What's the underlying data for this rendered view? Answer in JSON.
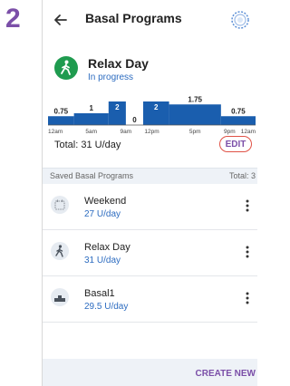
{
  "step_number": "2",
  "header": {
    "title": "Basal Programs",
    "back_icon": "back-arrow-icon",
    "status_icon": "pod-status-icon"
  },
  "active_program": {
    "name": "Relax Day",
    "status": "In progress",
    "icon": "walking-person-icon",
    "total_label": "Total: 31 U/day",
    "edit_label": "EDIT"
  },
  "chart_data": {
    "type": "bar",
    "segments": [
      {
        "start_hour": 0,
        "end_hour": 3,
        "rate": 0.75,
        "label": "0.75"
      },
      {
        "start_hour": 3,
        "end_hour": 7,
        "rate": 1,
        "label": "1"
      },
      {
        "start_hour": 7,
        "end_hour": 9,
        "rate": 2,
        "label": "2"
      },
      {
        "start_hour": 9,
        "end_hour": 11,
        "rate": 0,
        "label": "0"
      },
      {
        "start_hour": 11,
        "end_hour": 14,
        "rate": 2,
        "label": "2"
      },
      {
        "start_hour": 14,
        "end_hour": 20,
        "rate": 1.75,
        "label": "1.75"
      },
      {
        "start_hour": 20,
        "end_hour": 24,
        "rate": 0.75,
        "label": "0.75"
      }
    ],
    "xticks": [
      "12am",
      "5am",
      "9am",
      "12pm",
      "5pm",
      "9pm",
      "12am"
    ],
    "xtick_hours": [
      0,
      5,
      9,
      12,
      17,
      21,
      24
    ],
    "xlim": [
      0,
      24
    ],
    "ylim": [
      0,
      2
    ],
    "colors": {
      "bar": "#1a5eae",
      "label_on_bar": "#ffffff",
      "label": "#222222"
    }
  },
  "saved_section": {
    "title": "Saved Basal Programs",
    "total": "Total: 3"
  },
  "saved_programs": [
    {
      "name": "Weekend",
      "amount": "27 U/day",
      "icon": "calendar-icon"
    },
    {
      "name": "Relax Day",
      "amount": "31 U/day",
      "icon": "walking-person-icon"
    },
    {
      "name": "Basal1",
      "amount": "29.5 U/day",
      "icon": "basal-bars-icon"
    }
  ],
  "footer": {
    "create_new_label": "CREATE NEW"
  },
  "colors": {
    "accent_purple": "#7b4fa8",
    "link_blue": "#2d6cc0",
    "bar_blue": "#1a5eae",
    "active_green": "#1f9b4f",
    "edit_highlight": "#e05246"
  }
}
